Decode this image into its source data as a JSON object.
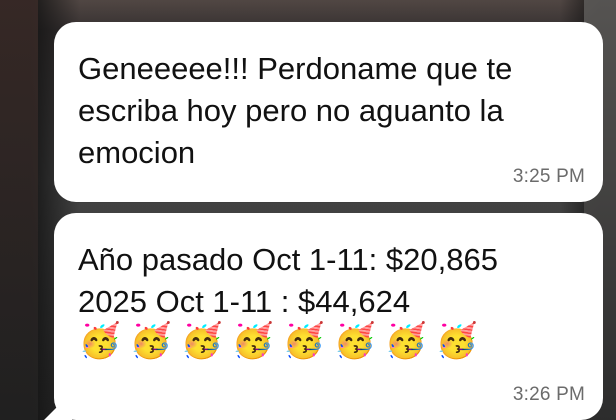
{
  "conversation": {
    "messages": [
      {
        "text": "Geneeeee!!! Perdoname que te\nescriba hoy pero no aguanto la\nemocion",
        "time": "3:25 PM"
      },
      {
        "text": "Año pasado Oct 1-11: $20,865\n2025 Oct 1-11 : $44,624",
        "emojis": [
          "🥳",
          "🥳",
          "🥳",
          "🥳",
          "🥳",
          "🥳",
          "🥳",
          "🥳"
        ],
        "time": "3:26 PM"
      }
    ]
  }
}
